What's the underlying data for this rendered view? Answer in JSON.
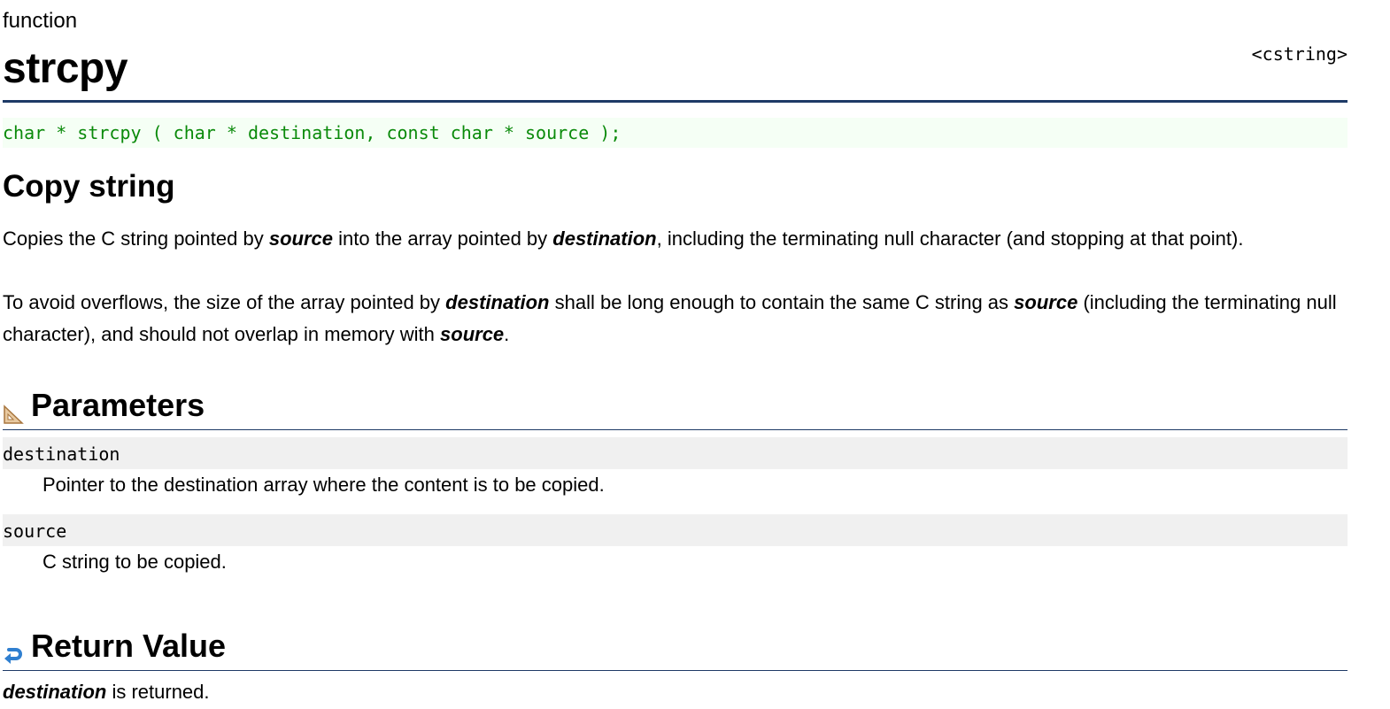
{
  "kind": "function",
  "header_name": "<cstring>",
  "title": "strcpy",
  "prototype": "char * strcpy ( char * destination, const char * source );",
  "subtitle": "Copy string",
  "description": {
    "p1": {
      "t1": "Copies the C string pointed by ",
      "e1": "source",
      "t2": " into the array pointed by ",
      "e2": "destination",
      "t3": ", including the terminating null character (and stopping at that point)."
    },
    "p2": {
      "t1": "To avoid overflows, the size of the array pointed by ",
      "e1": "destination",
      "t2": " shall be long enough to contain the same C string as ",
      "e2": "source",
      "t3": " (including the terminating null character), and should not overlap in memory with ",
      "e3": "source",
      "t4": "."
    }
  },
  "parameters": {
    "heading": "Parameters",
    "icon": "set-square-icon",
    "items": [
      {
        "name": "destination",
        "description": "Pointer to the destination array where the content is to be copied."
      },
      {
        "name": "source",
        "description": "C string to be copied."
      }
    ]
  },
  "return_value": {
    "heading": "Return Value",
    "icon": "return-arrow-icon",
    "emph": "destination",
    "text": " is returned."
  },
  "colors": {
    "rule": "#1e3a66",
    "prototype_text": "#0a8a0a",
    "prototype_bg": "#f5fff5",
    "param_bg": "#f0f0f0"
  }
}
